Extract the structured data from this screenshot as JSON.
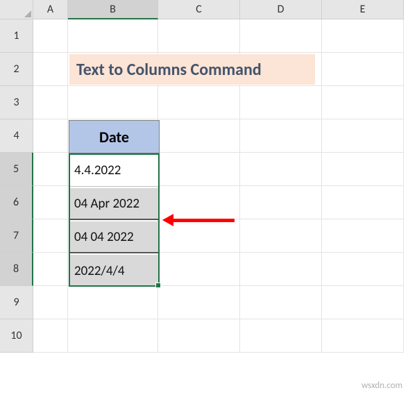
{
  "columns": [
    "A",
    "B",
    "C",
    "D",
    "E"
  ],
  "rows": [
    "1",
    "2",
    "3",
    "4",
    "5",
    "6",
    "7",
    "8",
    "9",
    "10"
  ],
  "title": "Text to Columns Command",
  "table": {
    "header": "Date",
    "values": [
      "4.4.2022",
      "04 Apr 2022",
      "04 04 2022",
      "2022/4/4"
    ]
  },
  "active_column_index": 1,
  "active_row_start": 4,
  "active_row_end": 7,
  "watermark": "wsxdn.com",
  "colors": {
    "title_bg": "#fce4d6",
    "title_fg": "#44546a",
    "header_bg": "#b4c6e7",
    "selection": "#217346",
    "arrow": "#ff0000"
  },
  "chart_data": {
    "type": "table",
    "title": "Text to Columns Command",
    "categories": [
      "Date"
    ],
    "values": [
      "4.4.2022",
      "04 Apr 2022",
      "04 04 2022",
      "2022/4/4"
    ]
  }
}
